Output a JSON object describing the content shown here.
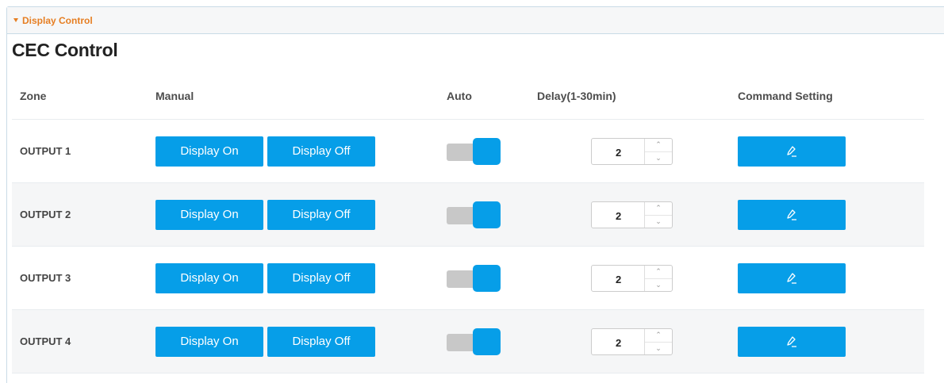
{
  "panel": {
    "title": "Display Control"
  },
  "section": {
    "title": "CEC Control"
  },
  "table": {
    "headers": {
      "zone": "Zone",
      "manual": "Manual",
      "auto": "Auto",
      "delay": "Delay(1-30min)",
      "command": "Command Setting"
    },
    "rows": [
      {
        "zone": "OUTPUT 1",
        "on_label": "Display On",
        "off_label": "Display Off",
        "auto": true,
        "delay": "2"
      },
      {
        "zone": "OUTPUT 2",
        "on_label": "Display On",
        "off_label": "Display Off",
        "auto": true,
        "delay": "2"
      },
      {
        "zone": "OUTPUT 3",
        "on_label": "Display On",
        "off_label": "Display Off",
        "auto": true,
        "delay": "2"
      },
      {
        "zone": "OUTPUT 4",
        "on_label": "Display On",
        "off_label": "Display Off",
        "auto": true,
        "delay": "2"
      }
    ]
  },
  "icons": {
    "edit": "pencil-icon",
    "stepper_up": "chevron-up-icon",
    "stepper_down": "chevron-down-icon",
    "collapse": "caret-down-icon"
  },
  "colors": {
    "accent": "#069ee8",
    "panel_title": "#e67e22",
    "toggle_track": "#c8c8c8"
  }
}
